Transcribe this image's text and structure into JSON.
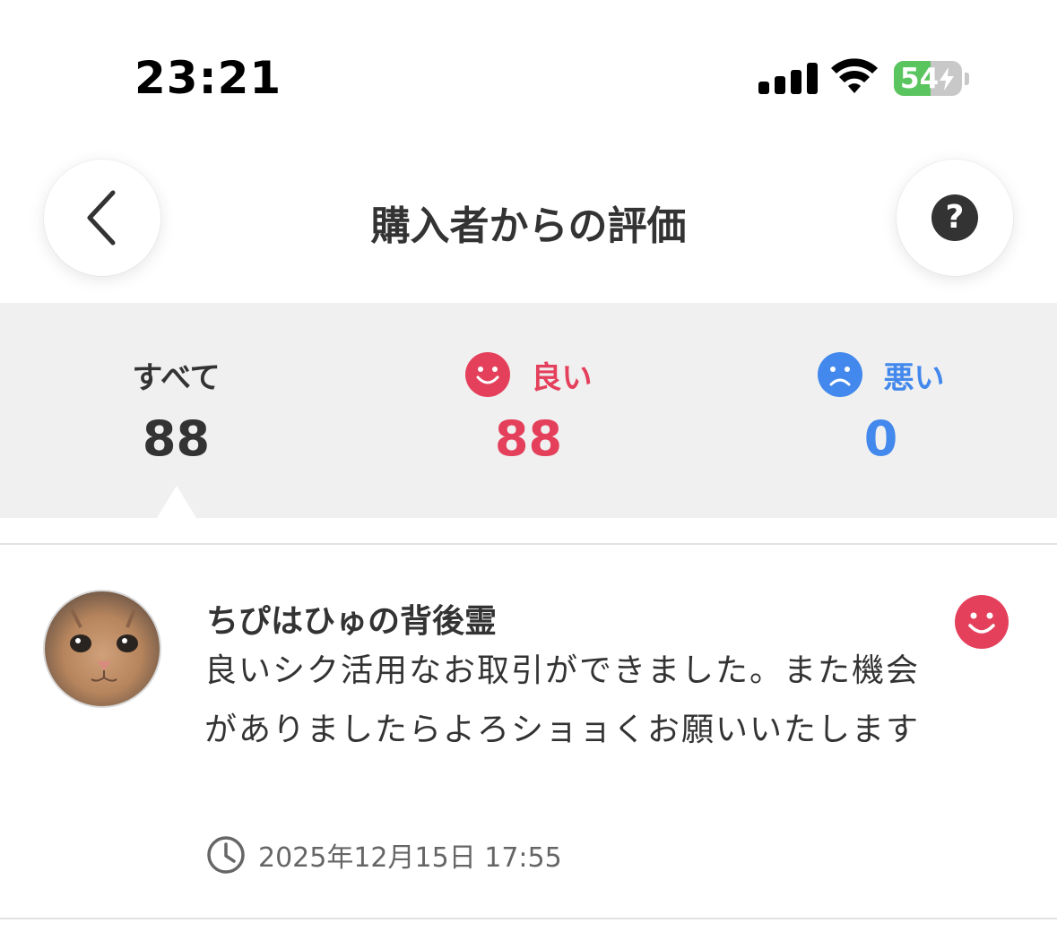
{
  "status_bar": {
    "time": "23:21",
    "battery_percent": "54",
    "battery_level": 0.54,
    "icons": [
      "signal-icon",
      "wifi-icon",
      "battery-icon",
      "charging-bolt-icon"
    ]
  },
  "header": {
    "title": "購入者からの評価",
    "back_icon": "chevron-left-icon",
    "help_icon": "question-circle-icon",
    "help_glyph": "?"
  },
  "tabs": [
    {
      "label": "すべて",
      "count": "88",
      "selected": true,
      "icon": null
    },
    {
      "label": "良い",
      "count": "88",
      "selected": false,
      "icon": "smile-face-icon",
      "color": "#e4405b"
    },
    {
      "label": "悪い",
      "count": "0",
      "selected": false,
      "icon": "sad-face-icon",
      "color": "#4388ec"
    }
  ],
  "reviews": [
    {
      "name": "ちぴはひゅの背後霊",
      "text": "良いシク活用なお取引ができました。また機会がありましたらよろショョくお願いいたします",
      "date": "2025年12月15日 17:55",
      "rating_icon": "smile-face-icon",
      "avatar_icon": "cat-avatar"
    }
  ],
  "colors": {
    "good": "#e4405b",
    "bad": "#4388ec",
    "text": "#333333",
    "tab_bg": "#f0f0f0"
  }
}
